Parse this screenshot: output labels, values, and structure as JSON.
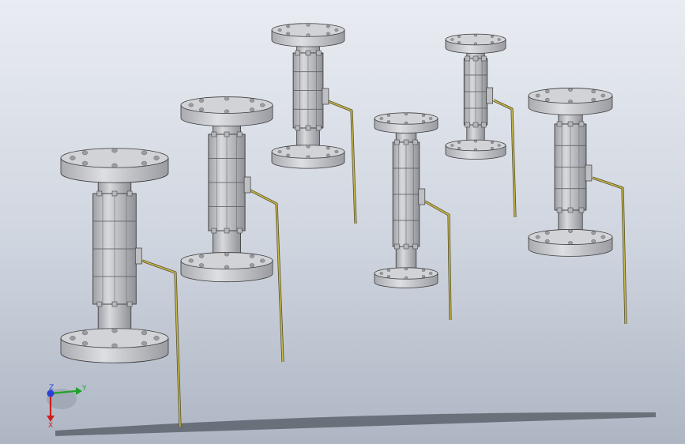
{
  "viewport": {
    "background_top": "#e9ecf2",
    "background_bottom": "#aeb6c4"
  },
  "model": {
    "valve_count": 6,
    "body_color": "#c9cace",
    "flange_color": "#d2d3d6",
    "handle_color": "#c8b74a",
    "edge_color": "#3a3a3a"
  },
  "triad": {
    "label_z": "Z",
    "label_y": "Y",
    "label_x": "X",
    "color_z": "#2a3fd6",
    "color_y": "#1fa32a",
    "color_x": "#cc1f1f"
  }
}
